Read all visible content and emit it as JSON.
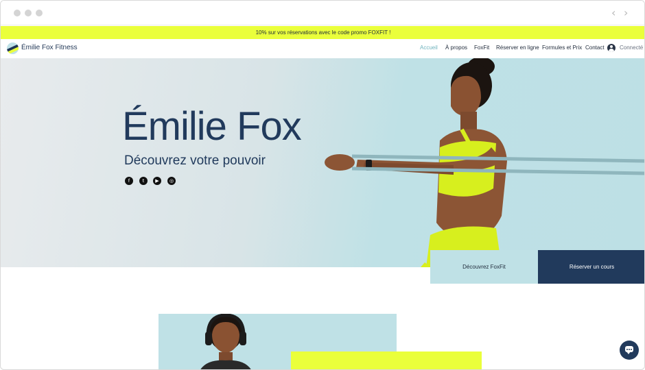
{
  "promo": {
    "text": "10% sur vos réservations avec le code promo FOXFIT !"
  },
  "header": {
    "brand": "Émilie Fox Fitness",
    "menu": [
      "Accueil",
      "À propos",
      "FoxFit",
      "Réserver en ligne",
      "Formules et Prix",
      "Contact"
    ],
    "active_item": "Accueil",
    "login_label": "Connecté"
  },
  "hero": {
    "title": "Émilie Fox",
    "subtitle": "Découvrez votre pouvoir",
    "social_icons": [
      "facebook-icon",
      "twitter-icon",
      "youtube-icon",
      "instagram-icon"
    ]
  },
  "cta": {
    "primary": "Découvrez FoxFit",
    "secondary": "Réserver un cours"
  },
  "colors": {
    "accent_yellow": "#eaff3b",
    "navy": "#213a5c",
    "light_teal": "#bfe1e6"
  }
}
